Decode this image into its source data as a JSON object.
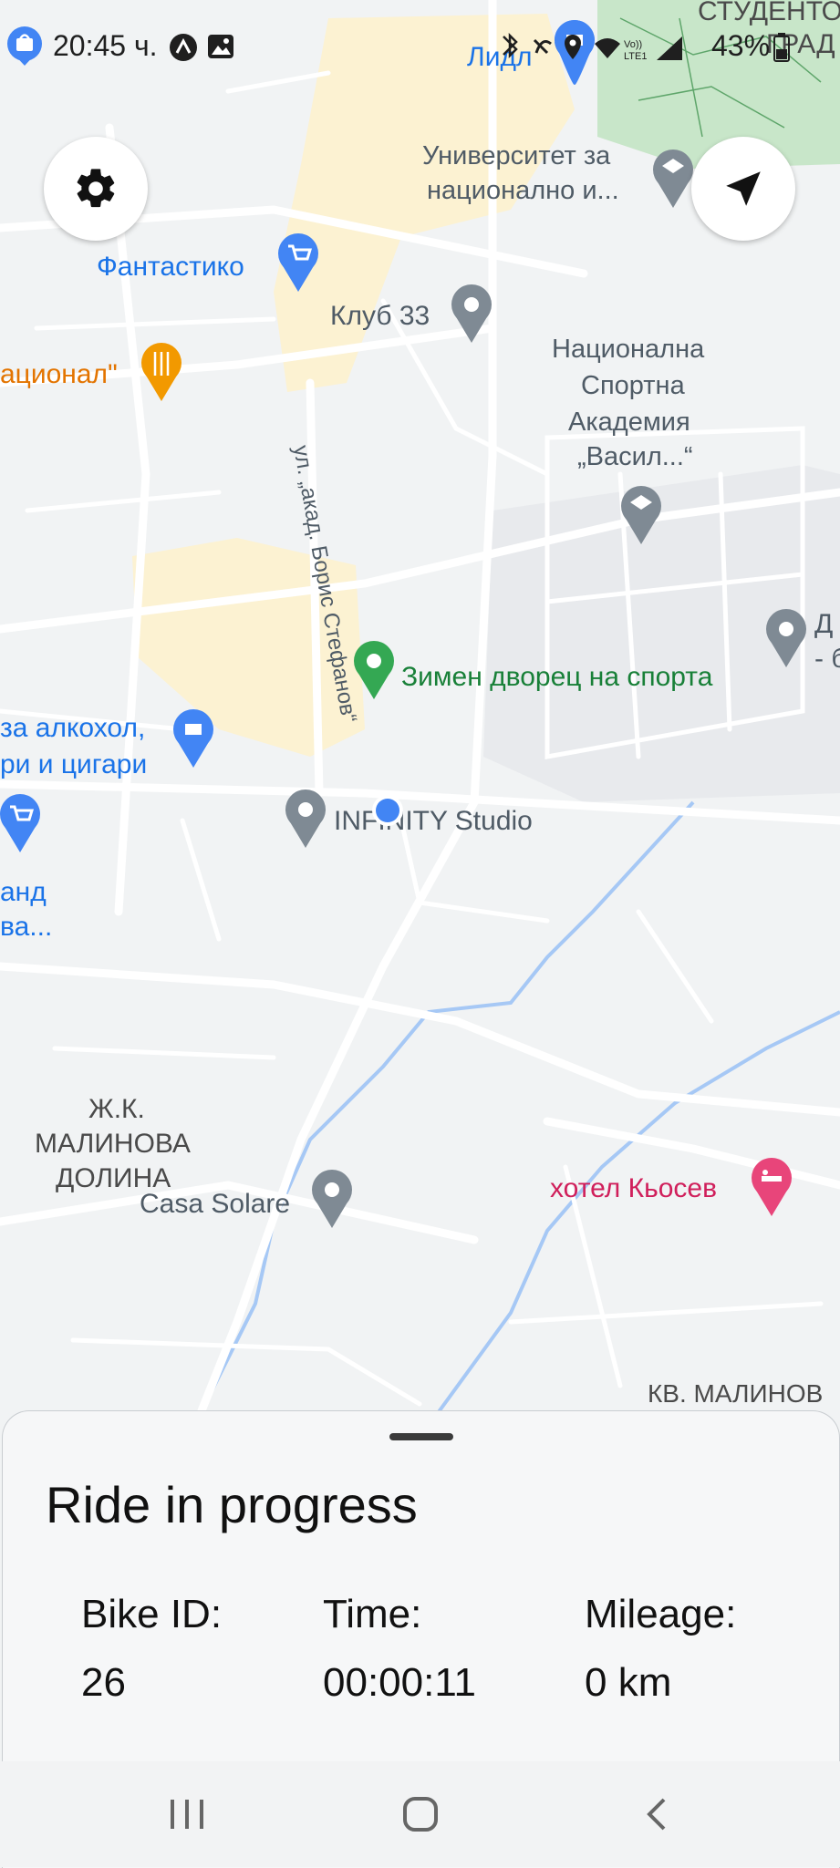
{
  "status_bar": {
    "time": "20:45 ч.",
    "battery": "43%"
  },
  "map": {
    "labels": {
      "lidl": "Лидл",
      "student_town": "СТУДЕНТО",
      "student_town2": "ГРАД",
      "university1": "Университет за",
      "university2": "национално и...",
      "fantastiko": "Фантастико",
      "club33": "Клуб 33",
      "nacional": "ационал\"",
      "nsa1": "Национална",
      "nsa2": "Спортна",
      "nsa3": "Академия",
      "nsa4": "„Васил...“",
      "street": "ул. „акад. Борис Стефанов“",
      "winter_palace": "Зимен дворец на спорта",
      "alcohol1": "за алкохол,",
      "alcohol2": "ри и цигари",
      "infinity": "INFINITY Studio",
      "and1": "анд",
      "and2": "ва...",
      "d1": "Д",
      "d2": "- б",
      "malinova1": "Ж.К.",
      "malinova2": "МАЛИНОВА",
      "malinova3": "ДОЛИНА",
      "casa_solare": "Casa Solare",
      "hotel": "хотел Кьосев",
      "kv_malinova": "КВ. МАЛИНОВ"
    }
  },
  "buttons": {
    "settings_icon": "gear-icon",
    "locate_icon": "navigation-arrow-icon"
  },
  "ride_sheet": {
    "title": "Ride in progress",
    "bike_id_label": "Bike ID:",
    "bike_id_value": "26",
    "time_label": "Time:",
    "time_value": "00:00:11",
    "mileage_label": "Mileage:",
    "mileage_value": "0 km"
  },
  "colors": {
    "map_background": "#f1f3f4",
    "road": "#ffffff",
    "park": "#c8e6c9",
    "commercial": "#fcf2d2",
    "water": "#a6c8f5",
    "poi_gray": "#7f8a94",
    "poi_blue": "#4285f4",
    "poi_green": "#34a853",
    "poi_orange": "#f29900",
    "poi_pink": "#e8457a",
    "location_dot": "#4285f4"
  }
}
